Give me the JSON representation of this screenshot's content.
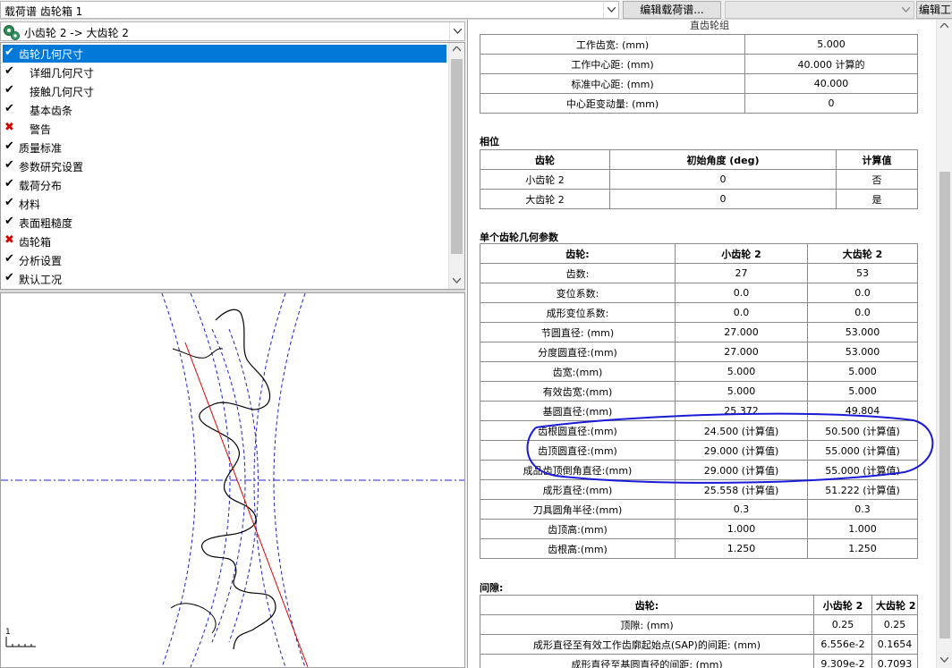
{
  "toolbar": {
    "load_combo_text": "载荷谱 齿轮箱 1",
    "edit_loadspec_label": "编辑载荷谱...",
    "right_combo_text": "",
    "edit_condition_label": "编辑工况"
  },
  "left": {
    "gearset_combo_text": "小齿轮 2 -> 大齿轮 2",
    "tree_items": [
      {
        "label": "齿轮几何尺寸",
        "status": "ok",
        "selected": true
      },
      {
        "label": "详细几何尺寸",
        "status": "ok"
      },
      {
        "label": "接触几何尺寸",
        "status": "ok"
      },
      {
        "label": "基本齿条",
        "status": "ok"
      },
      {
        "label": "警告",
        "status": "error"
      },
      {
        "label": "质量标准",
        "status": "ok"
      },
      {
        "label": "参数研究设置",
        "status": "ok"
      },
      {
        "label": "载荷分布",
        "status": "ok"
      },
      {
        "label": "材料",
        "status": "ok"
      },
      {
        "label": "表面粗糙度",
        "status": "ok"
      },
      {
        "label": "齿轮箱",
        "status": "error"
      },
      {
        "label": "分析设置",
        "status": "ok"
      },
      {
        "label": "默认工况",
        "status": "ok"
      }
    ],
    "scale_label": "1"
  },
  "report": {
    "partial_title": "直齿轮组",
    "center_table": {
      "rows": [
        [
          "工作齿宽: (mm)",
          "5.000"
        ],
        [
          "工作中心距: (mm)",
          "40.000 计算的"
        ],
        [
          "标准中心距: (mm)",
          "40.000"
        ],
        [
          "中心距变动量: (mm)",
          "0"
        ]
      ]
    },
    "phase": {
      "title": "相位",
      "headers": [
        "齿轮",
        "初始角度 (deg)",
        "计算值"
      ],
      "rows": [
        [
          "小齿轮 2",
          "0",
          "否"
        ],
        [
          "大齿轮 2",
          "0",
          "是"
        ]
      ]
    },
    "single_gear": {
      "title": "单个齿轮几何参数",
      "headers": [
        "齿轮:",
        "小齿轮 2",
        "大齿轮 2"
      ],
      "rows": [
        [
          "齿数:",
          "27",
          "53"
        ],
        [
          "变位系数:",
          "0.0",
          "0.0"
        ],
        [
          "成形变位系数:",
          "0.0",
          "0.0"
        ],
        [
          "节圆直径: (mm)",
          "27.000",
          "53.000"
        ],
        [
          "分度圆直径:(mm)",
          "27.000",
          "53.000"
        ],
        [
          "齿宽:(mm)",
          "5.000",
          "5.000"
        ],
        [
          "有效齿宽:(mm)",
          "5.000",
          "5.000"
        ],
        [
          "基圆直径:(mm)",
          "25.372",
          "49.804"
        ],
        [
          "齿根圆直径:(mm)",
          "24.500 (计算值)",
          "50.500 (计算值)"
        ],
        [
          "齿顶圆直径:(mm)",
          "29.000 (计算值)",
          "55.000 (计算值)"
        ],
        [
          "成品齿顶倒角直径:(mm)",
          "29.000 (计算值)",
          "55.000 (计算值)"
        ],
        [
          "成形直径:(mm)",
          "25.558 (计算值)",
          "51.222 (计算值)"
        ],
        [
          "刀具圆角半径:(mm)",
          "0.3",
          "0.3"
        ],
        [
          "齿顶高:(mm)",
          "1.000",
          "1.000"
        ],
        [
          "齿根高:(mm)",
          "1.250",
          "1.250"
        ]
      ]
    },
    "clearance": {
      "title": "间隙:",
      "headers": [
        "齿轮:",
        "小齿轮 2",
        "大齿轮 2"
      ],
      "rows": [
        [
          "顶隙: (mm)",
          "0.25",
          "0.25"
        ],
        [
          "成形直径至有效工作齿廓起始点(SAP)的间距: (mm)",
          "6.556e-2",
          "0.1654"
        ],
        [
          "成形直径至基圆直径的间距: (mm)",
          "9.309e-2",
          "0.7093"
        ]
      ]
    }
  },
  "colors": {
    "selection": "#0078d7",
    "error_mark": "#d00000",
    "annotation_ellipse": "#1a1ad6",
    "tooth_profile": "#000000",
    "pitch_circles": "#2020d0",
    "line_of_action": "#e00000"
  }
}
